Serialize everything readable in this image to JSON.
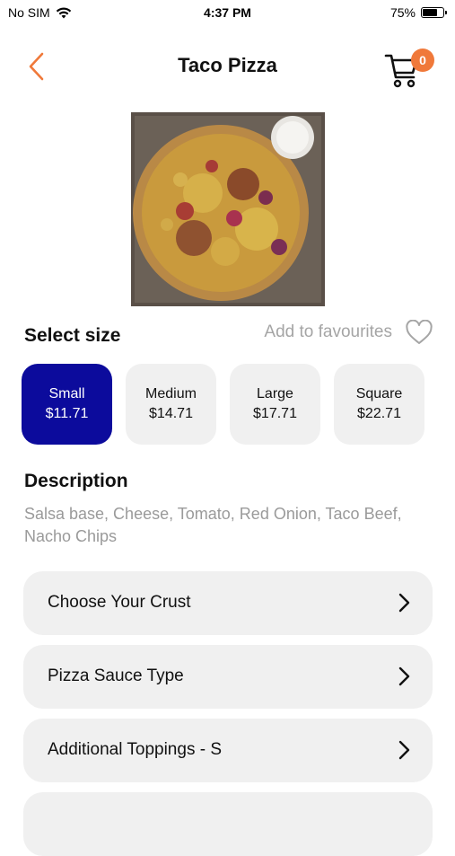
{
  "status_bar": {
    "carrier": "No SIM",
    "time": "4:37 PM",
    "battery_percent_text": "75%",
    "battery_level": 0.75
  },
  "header": {
    "title": "Taco Pizza",
    "cart_count": "0",
    "back_icon": "chevron-left-icon",
    "cart_icon": "cart-icon"
  },
  "product": {
    "image_icon": "pizza-image"
  },
  "size_section": {
    "label": "Select size",
    "favourites_label": "Add to favourites",
    "favourite_icon": "heart-icon",
    "options": [
      {
        "name": "Small",
        "price": "$11.71",
        "selected": true
      },
      {
        "name": "Medium",
        "price": "$14.71",
        "selected": false
      },
      {
        "name": "Large",
        "price": "$17.71",
        "selected": false
      },
      {
        "name": "Square",
        "price": "$22.71",
        "selected": false
      }
    ]
  },
  "description": {
    "label": "Description",
    "text": "Salsa base, Cheese, Tomato, Red Onion, Taco Beef, Nacho Chips"
  },
  "options": [
    {
      "label": "Choose Your Crust"
    },
    {
      "label": "Pizza Sauce Type"
    },
    {
      "label": "Additional Toppings - S"
    },
    {
      "label": ""
    }
  ],
  "colors": {
    "accent": "#f0793a",
    "selected": "#0c0b9c",
    "card_bg": "#f0f0f0",
    "muted_text": "#9a9a9a"
  }
}
